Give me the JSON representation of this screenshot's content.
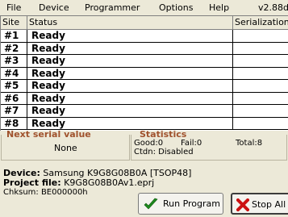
{
  "menu": {
    "items": [
      "File",
      "Device",
      "Programmer",
      "Options",
      "Help"
    ],
    "version": "v2.88d"
  },
  "grid": {
    "columns": [
      "Site",
      "Status",
      "Serialization"
    ],
    "rows": [
      {
        "site": "#1",
        "status": "Ready"
      },
      {
        "site": "#2",
        "status": "Ready"
      },
      {
        "site": "#3",
        "status": "Ready"
      },
      {
        "site": "#4",
        "status": "Ready"
      },
      {
        "site": "#5",
        "status": "Ready"
      },
      {
        "site": "#6",
        "status": "Ready"
      },
      {
        "site": "#7",
        "status": "Ready"
      },
      {
        "site": "#8",
        "status": "Ready"
      }
    ]
  },
  "serial": {
    "title": "Next serial value",
    "value": "None"
  },
  "statistics": {
    "title": "Statistics",
    "good": "Good:0",
    "fail": "Fail:0",
    "total": "Total:8",
    "ctdn": "Ctdn: Disabled"
  },
  "info": {
    "device_label": "Device:",
    "device_value": "Samsung K9G8G08B0A [TSOP48]",
    "project_label": "Project file:",
    "project_value": "K9G8G08B0Av1.eprj",
    "checksum": "Chksum: BE000000h"
  },
  "buttons": {
    "run_label": "Run Program",
    "stop_label": "Stop All"
  },
  "colors": {
    "group_title": "#a0522d",
    "check_icon": "#1e8a1e",
    "stop_icon": "#cc1111"
  }
}
